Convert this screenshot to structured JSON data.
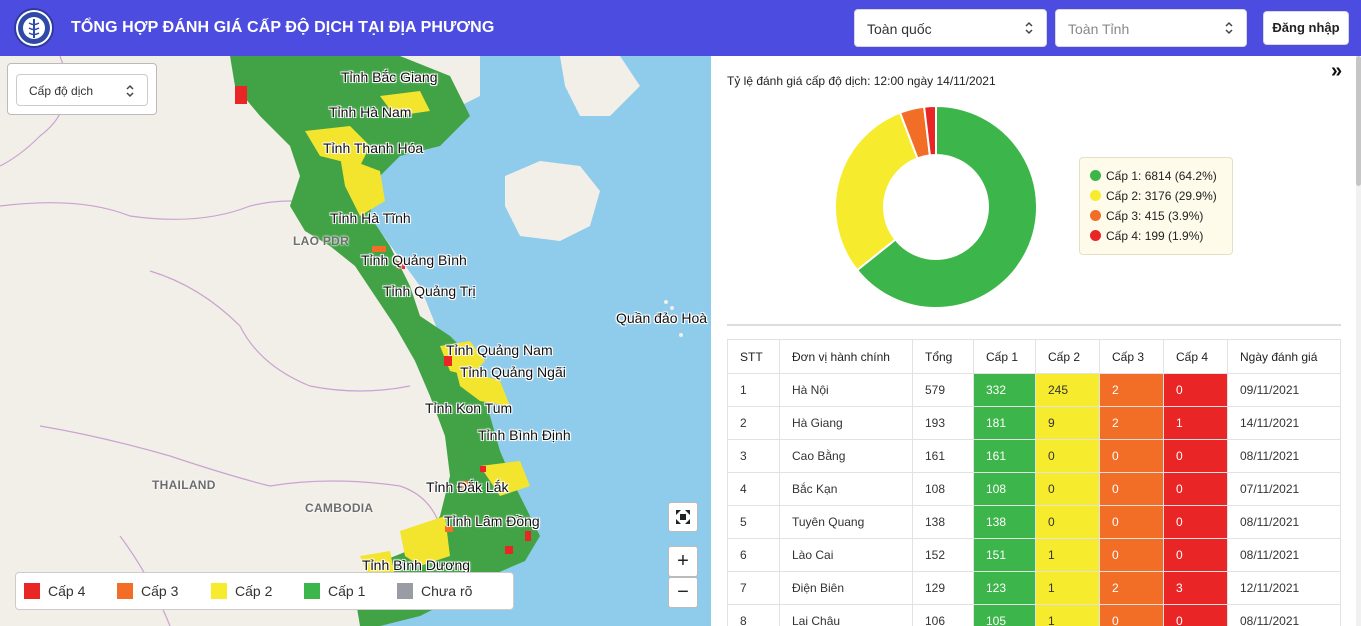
{
  "header": {
    "title": "TỔNG HỢP ĐÁNH GIÁ CẤP ĐỘ DỊCH TẠI ĐỊA PHƯƠNG",
    "nation_select": "Toàn quốc",
    "province_select": "Toàn Tỉnh",
    "login_label": "Đăng nhập"
  },
  "map": {
    "layer_select": "Cấp độ dịch",
    "province_labels": [
      "Tỉnh Bắc Giang",
      "Tỉnh Hà Nam",
      "Tỉnh Thanh Hóa",
      "Tỉnh Hà Tĩnh",
      "Tỉnh Quảng Bình",
      "Tỉnh Quảng Trị",
      "Tỉnh Quảng Nam",
      "Tỉnh Quảng Ngãi",
      "Tỉnh Kon Tum",
      "Tỉnh Bình Định",
      "Tỉnh Đắk Lắk",
      "Tỉnh Lâm Đồng",
      "Tỉnh Bình Dương",
      "Quần đảo Hoà"
    ],
    "country_labels": [
      "LAO PDR",
      "THAILAND",
      "CAMBODIA"
    ],
    "zoom_in": "+",
    "zoom_out": "−",
    "legend": [
      {
        "label": "Cấp 4",
        "color": "#ea2525"
      },
      {
        "label": "Cấp 3",
        "color": "#f26d25"
      },
      {
        "label": "Cấp 2",
        "color": "#f6ec2d"
      },
      {
        "label": "Cấp 1",
        "color": "#3cb54a"
      },
      {
        "label": "Chưa rõ",
        "color": "#9b9ba6"
      }
    ]
  },
  "panel": {
    "rate_title": "Tỷ lệ đánh giá cấp độ dịch: 12:00 ngày 14/11/2021",
    "collapse_icon": "»"
  },
  "chart_data": {
    "type": "pie",
    "categories": [
      "Cấp 1",
      "Cấp 2",
      "Cấp 3",
      "Cấp 4"
    ],
    "values": [
      6814,
      3176,
      415,
      199
    ],
    "legend_labels": [
      "Cấp 1: 6814 (64.2%)",
      "Cấp 2: 3176 (29.9%)",
      "Cấp 3: 415 (3.9%)",
      "Cấp 4: 199 (1.9%)"
    ],
    "colors": [
      "#3cb54a",
      "#f6ec2d",
      "#f26d25",
      "#ea2525"
    ],
    "legend_placement": "right"
  },
  "table": {
    "headers": [
      "STT",
      "Đơn vị hành chính",
      "Tổng",
      "Cấp 1",
      "Cấp 2",
      "Cấp 3",
      "Cấp 4",
      "Ngày đánh giá"
    ],
    "rows": [
      [
        "1",
        "Hà Nội",
        "579",
        "332",
        "245",
        "2",
        "0",
        "09/11/2021"
      ],
      [
        "2",
        "Hà Giang",
        "193",
        "181",
        "9",
        "2",
        "1",
        "14/11/2021"
      ],
      [
        "3",
        "Cao Bằng",
        "161",
        "161",
        "0",
        "0",
        "0",
        "08/11/2021"
      ],
      [
        "4",
        "Bắc Kạn",
        "108",
        "108",
        "0",
        "0",
        "0",
        "07/11/2021"
      ],
      [
        "5",
        "Tuyên Quang",
        "138",
        "138",
        "0",
        "0",
        "0",
        "08/11/2021"
      ],
      [
        "6",
        "Lào Cai",
        "152",
        "151",
        "1",
        "0",
        "0",
        "08/11/2021"
      ],
      [
        "7",
        "Điện Biên",
        "129",
        "123",
        "1",
        "2",
        "3",
        "12/11/2021"
      ],
      [
        "8",
        "Lai Châu",
        "106",
        "105",
        "1",
        "0",
        "0",
        "08/11/2021"
      ]
    ]
  }
}
